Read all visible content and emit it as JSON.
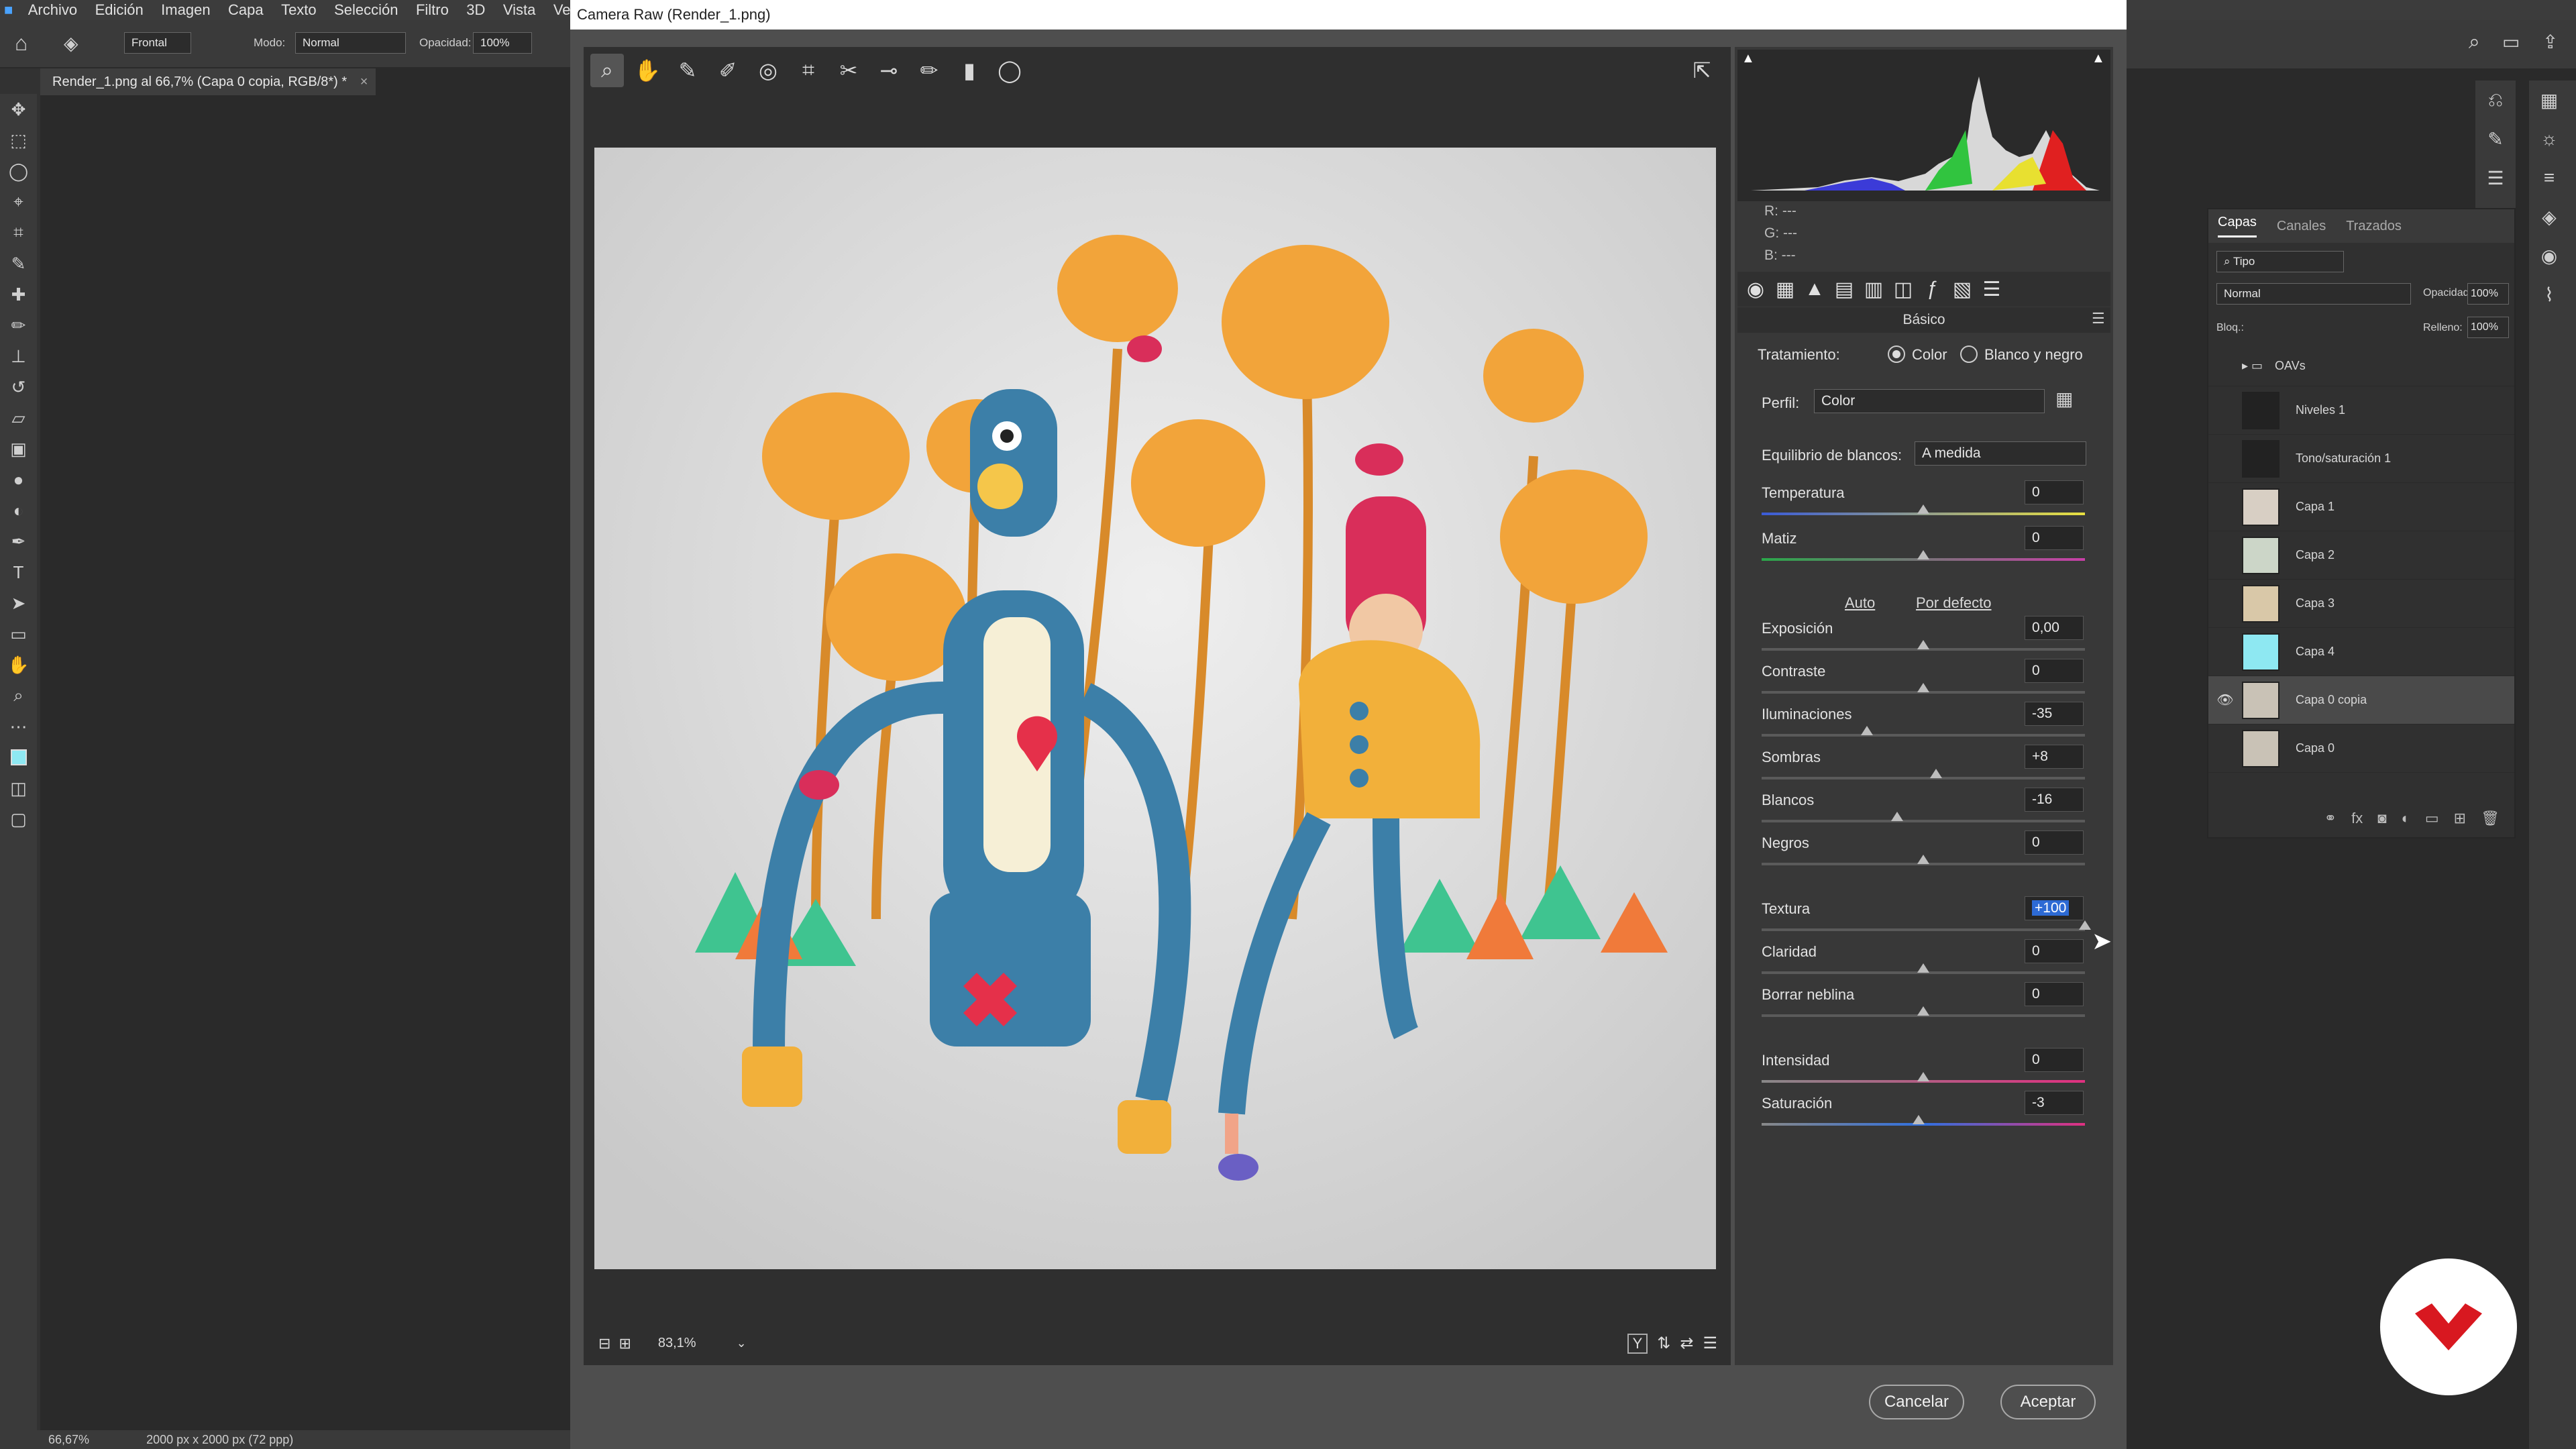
{
  "menubar": {
    "items": [
      "Archivo",
      "Edición",
      "Imagen",
      "Capa",
      "Texto",
      "Selección",
      "Filtro",
      "3D",
      "Vista",
      "Ventana"
    ]
  },
  "options_bar": {
    "preset": "Frontal",
    "mode_label": "Modo:",
    "mode_value": "Normal",
    "opacity_label": "Opacidad:",
    "opacity_value": "100%"
  },
  "document_tab": {
    "title": "Render_1.png al 66,7% (Capa 0 copia, RGB/8*) *",
    "close": "×"
  },
  "status_bar": {
    "zoom": "66,67%",
    "doc_info": "2000 px x 2000 px (72 ppp)"
  },
  "camera_raw": {
    "window_title": "Camera Raw (Render_1.png)",
    "rgb": {
      "r": "R:  ---",
      "g": "G:  ---",
      "b": "B:  ---"
    },
    "panel_title": "Básico",
    "treatment": {
      "label": "Tratamiento:",
      "color": "Color",
      "bw": "Blanco y negro",
      "selected": "Color"
    },
    "profile": {
      "label": "Perfil:",
      "value": "Color"
    },
    "white_balance": {
      "label": "Equilibrio de blancos:",
      "value": "A medida"
    },
    "auto": "Auto",
    "default": "Por defecto",
    "sliders": {
      "temperature": {
        "label": "Temperatura",
        "value": "0"
      },
      "tint": {
        "label": "Matiz",
        "value": "0"
      },
      "exposure": {
        "label": "Exposición",
        "value": "0,00"
      },
      "contrast": {
        "label": "Contraste",
        "value": "0"
      },
      "highlights": {
        "label": "Iluminaciones",
        "value": "-35"
      },
      "shadows": {
        "label": "Sombras",
        "value": "+8"
      },
      "whites": {
        "label": "Blancos",
        "value": "-16"
      },
      "blacks": {
        "label": "Negros",
        "value": "0"
      },
      "texture": {
        "label": "Textura",
        "value": "+100"
      },
      "clarity": {
        "label": "Claridad",
        "value": "0"
      },
      "dehaze": {
        "label": "Borrar neblina",
        "value": "0"
      },
      "vibrance": {
        "label": "Intensidad",
        "value": "0"
      },
      "saturation": {
        "label": "Saturación",
        "value": "-3"
      }
    },
    "zoom": "83,1%",
    "cancel": "Cancelar",
    "accept": "Aceptar"
  },
  "layers_panel": {
    "tabs": [
      "Capas",
      "Canales",
      "Trazados"
    ],
    "active_tab": "Capas",
    "filter": "Tipo",
    "blend": "Normal",
    "opacity_label": "Opacidad:",
    "opacity_value": "100%",
    "lock_label": "Bloq.:",
    "fill_label": "Relleno:",
    "fill_value": "100%",
    "layers": [
      "OAVs",
      "Niveles 1",
      "Tono/saturación 1",
      "Capa 1",
      "Capa 2",
      "Capa 3",
      "Capa 4",
      "Capa 0 copia",
      "Capa 0"
    ],
    "selected": "Capa 0 copia"
  },
  "colors": {
    "accent": "#2d6ad4",
    "logo_red": "#d81820"
  }
}
